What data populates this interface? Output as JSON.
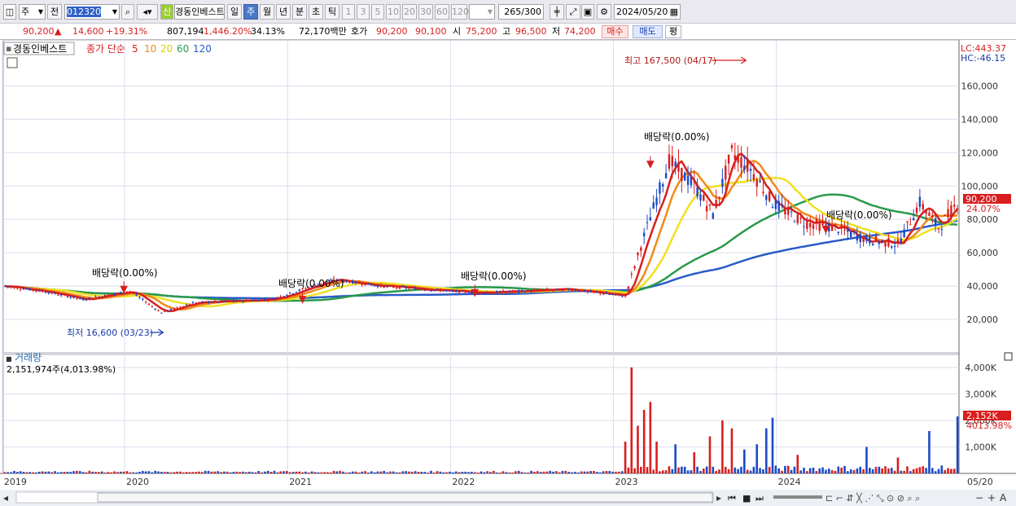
{
  "toolbar": {
    "period_value": "주",
    "prev_label": "전",
    "code": "012320",
    "stock_name": "경동인베스트",
    "sin_badge": "신",
    "period_tabs": [
      "일",
      "주",
      "월",
      "년",
      "분",
      "초",
      "틱"
    ],
    "active_tab": "주",
    "numbers": [
      "1",
      "3",
      "5",
      "10",
      "20",
      "30",
      "60",
      "120"
    ],
    "count": "265",
    "count_total": "/300",
    "date": "2024/05/20"
  },
  "quote": {
    "price": "90,200",
    "arrow": "▲",
    "change": "14,600",
    "change_pct": "+19.31%",
    "volume": "807,194",
    "volume_pct": "1,446.20%",
    "turnover": "34.13%",
    "amount": "72,170백만",
    "hoga_label": "호가",
    "ask": "90,200",
    "bid": "90,100",
    "open_label": "시",
    "open": "75,200",
    "high_label": "고",
    "high": "96,500",
    "low_label": "저",
    "low": "74,200",
    "buy": "매수",
    "sell": "매도",
    "eval": "평"
  },
  "panel": {
    "name": "경동인베스트",
    "ma_title": "종가 단순",
    "ma_periods": [
      "5",
      "10",
      "20",
      "60",
      "120"
    ],
    "lc": "LC:443.37",
    "hc": "HC:-46.15",
    "max_label": "최고 167,500 (04/17)",
    "min_label": "최저 16,600 (03/23)",
    "dividend": "배당락(0.00%)",
    "price_tag": "90,200",
    "pct_tag": "24.07%",
    "vol_title": "거래량",
    "vol_value": "2,151,974주(4,013.98%)",
    "vol_tag": "2,152K",
    "vol_pct_tag": "4013.98%"
  },
  "axes": {
    "price_ticks": [
      "160,000",
      "140,000",
      "120,000",
      "100,000",
      "80,000",
      "60,000",
      "40,000",
      "20,000"
    ],
    "price_values": [
      160000,
      140000,
      120000,
      100000,
      80000,
      60000,
      40000,
      20000
    ],
    "vol_ticks": [
      "4,000K",
      "3,000K",
      "2,000K",
      "1,000K"
    ],
    "vol_values": [
      4000,
      3000,
      2000,
      1000
    ],
    "years": [
      "2019",
      "2020",
      "2021",
      "2022",
      "2023",
      "2024"
    ],
    "last_date": "05/20"
  },
  "chart_data": {
    "type": "candlestick",
    "ylim": [
      0,
      170000
    ],
    "ma_colors": {
      "ma5": "#d81e1e",
      "ma10": "#f08a18",
      "ma20": "#f0e020",
      "ma60": "#2a9a4a",
      "ma120": "#2a5ac8"
    },
    "price_approx": [
      [
        0,
        40000
      ],
      [
        12,
        37000
      ],
      [
        25,
        32000
      ],
      [
        40,
        37000
      ],
      [
        50,
        24000
      ],
      [
        60,
        30000
      ],
      [
        85,
        32000
      ],
      [
        105,
        44000
      ],
      [
        120,
        40000
      ],
      [
        150,
        36000
      ],
      [
        180,
        38000
      ],
      [
        198,
        34000
      ],
      [
        204,
        70000
      ],
      [
        212,
        115000
      ],
      [
        220,
        100000
      ],
      [
        226,
        83000
      ],
      [
        232,
        120000
      ],
      [
        238,
        110000
      ],
      [
        245,
        90000
      ],
      [
        255,
        78000
      ],
      [
        265,
        75000
      ],
      [
        275,
        68000
      ],
      [
        285,
        65000
      ],
      [
        292,
        90000
      ],
      [
        298,
        75000
      ],
      [
        304,
        90000
      ]
    ],
    "dividends": [
      [
        38,
        36000
      ],
      [
        95,
        30000
      ],
      [
        150,
        34000
      ],
      [
        206,
        111000
      ],
      [
        262,
        72000
      ]
    ],
    "volume_k": [
      [
        198,
        1200
      ],
      [
        200,
        4000
      ],
      [
        202,
        1800
      ],
      [
        204,
        2400
      ],
      [
        206,
        2700
      ],
      [
        208,
        1200
      ],
      [
        214,
        1100
      ],
      [
        220,
        800
      ],
      [
        225,
        1400
      ],
      [
        229,
        2000
      ],
      [
        232,
        1700
      ],
      [
        236,
        900
      ],
      [
        240,
        1100
      ],
      [
        243,
        1700
      ],
      [
        245,
        2100
      ],
      [
        253,
        700
      ],
      [
        275,
        1000
      ],
      [
        285,
        600
      ],
      [
        295,
        1600
      ],
      [
        301,
        200
      ],
      [
        304,
        2150
      ]
    ]
  }
}
